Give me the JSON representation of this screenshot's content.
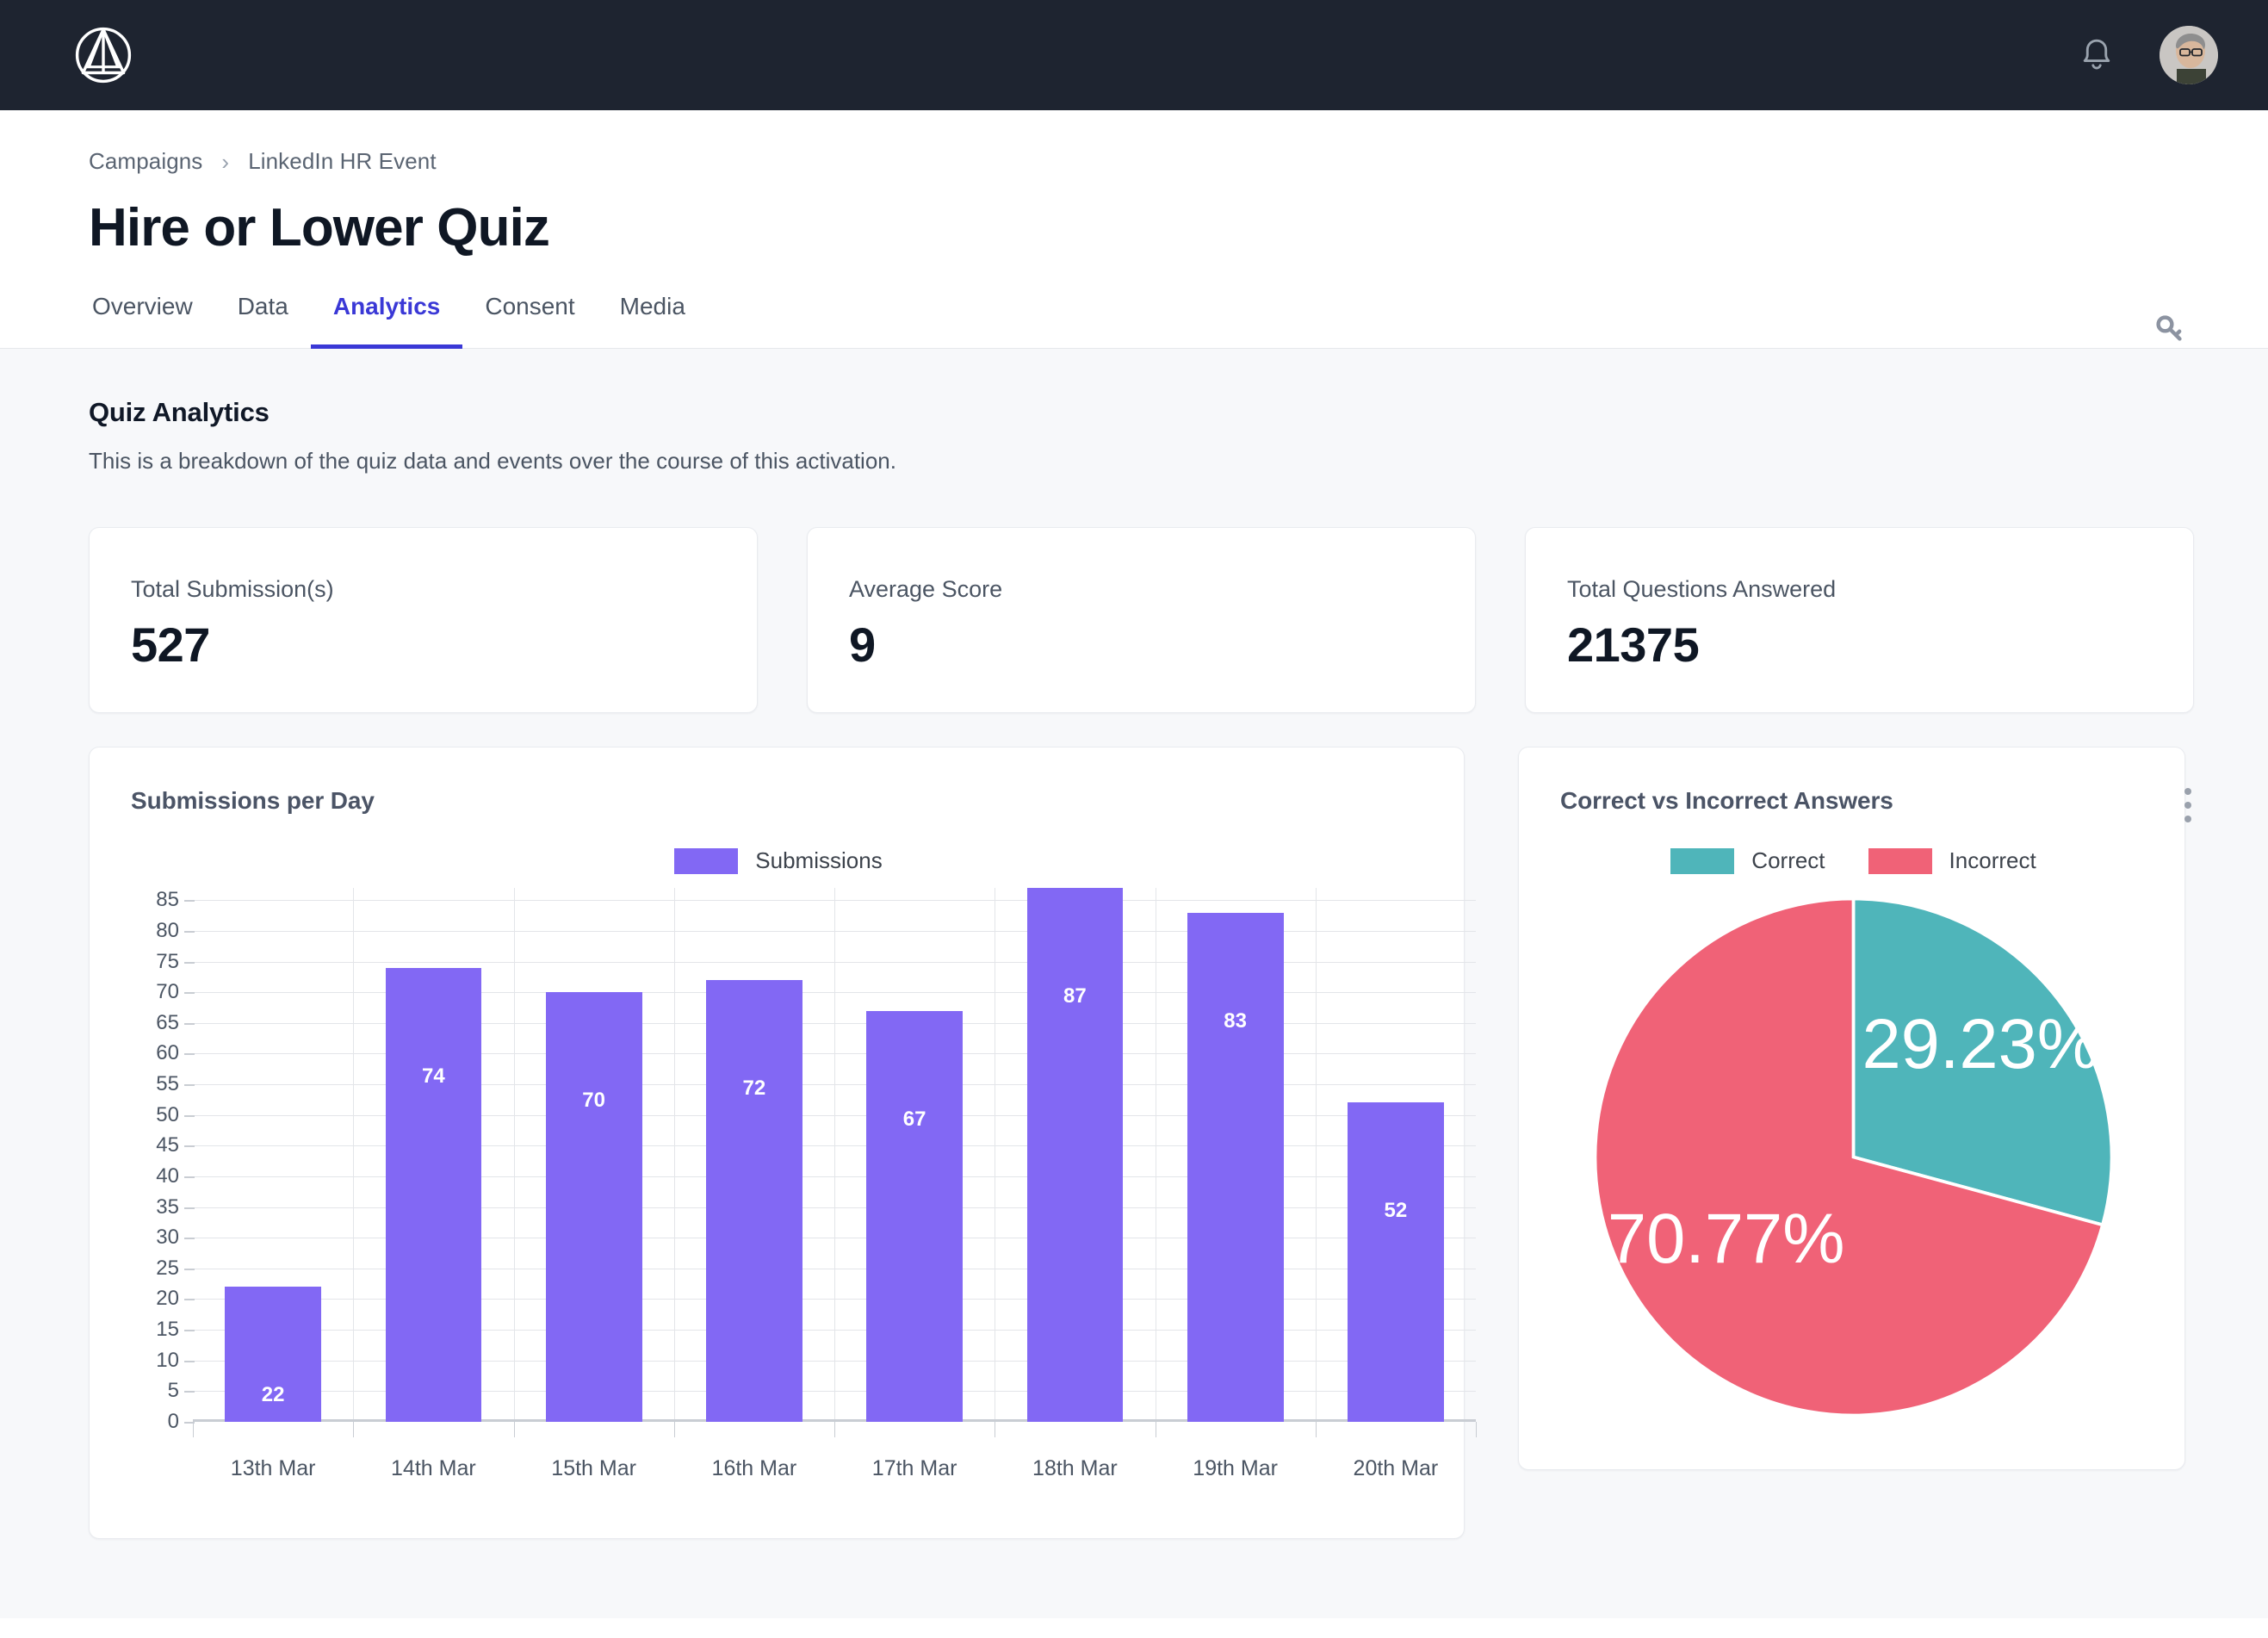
{
  "topbar": {
    "logo_icon": "triangle-in-circle-logo",
    "bell_icon": "notification-bell-icon",
    "avatar_icon": "user-avatar"
  },
  "header": {
    "breadcrumb": {
      "parent": "Campaigns",
      "separator": "›",
      "current": "LinkedIn HR Event"
    },
    "title": "Hire or Lower Quiz",
    "key_icon": "key-icon",
    "tabs": [
      {
        "label": "Overview",
        "active": false
      },
      {
        "label": "Data",
        "active": false
      },
      {
        "label": "Analytics",
        "active": true
      },
      {
        "label": "Consent",
        "active": false
      },
      {
        "label": "Media",
        "active": false
      }
    ]
  },
  "main": {
    "section_title": "Quiz Analytics",
    "section_subtitle": "This is a breakdown of the quiz data and events over the course of this activation.",
    "kebab_icon": "more-options-icon",
    "stats": [
      {
        "label": "Total Submission(s)",
        "value": "527"
      },
      {
        "label": "Average Score",
        "value": "9"
      },
      {
        "label": "Total Questions Answered",
        "value": "21375"
      }
    ]
  },
  "colors": {
    "bar": "#8268F4",
    "correct": "#4FB5BA",
    "incorrect": "#F06277",
    "accent": "#3A38D6",
    "topbar": "#1E2430",
    "page_bg": "#F7F8FA"
  },
  "chart_data": [
    {
      "type": "bar",
      "title": "Submissions per Day",
      "categories": [
        "13th Mar",
        "14th Mar",
        "15th Mar",
        "16th Mar",
        "17th Mar",
        "18th Mar",
        "19th Mar",
        "20th Mar"
      ],
      "series": [
        {
          "name": "Submissions",
          "values": [
            22,
            74,
            70,
            72,
            67,
            87,
            83,
            52
          ],
          "color": "#8268F4"
        }
      ],
      "legend": [
        "Submissions"
      ],
      "legend_position": "top-center",
      "xlabel": "",
      "ylabel": "",
      "ylim": [
        0,
        87
      ],
      "yticks": [
        0,
        5,
        10,
        15,
        20,
        25,
        30,
        35,
        40,
        45,
        50,
        55,
        60,
        65,
        70,
        75,
        80,
        85
      ],
      "grid": true,
      "data_labels": true
    },
    {
      "type": "pie",
      "title": "Correct vs Incorrect Answers",
      "labels": [
        "Correct",
        "Incorrect"
      ],
      "values": [
        29.23,
        70.77
      ],
      "value_labels": [
        "29.23%",
        "70.77%"
      ],
      "colors": [
        "#4FB5BA",
        "#F06277"
      ],
      "legend": [
        "Correct",
        "Incorrect"
      ],
      "legend_position": "top-center",
      "grid": false
    }
  ]
}
